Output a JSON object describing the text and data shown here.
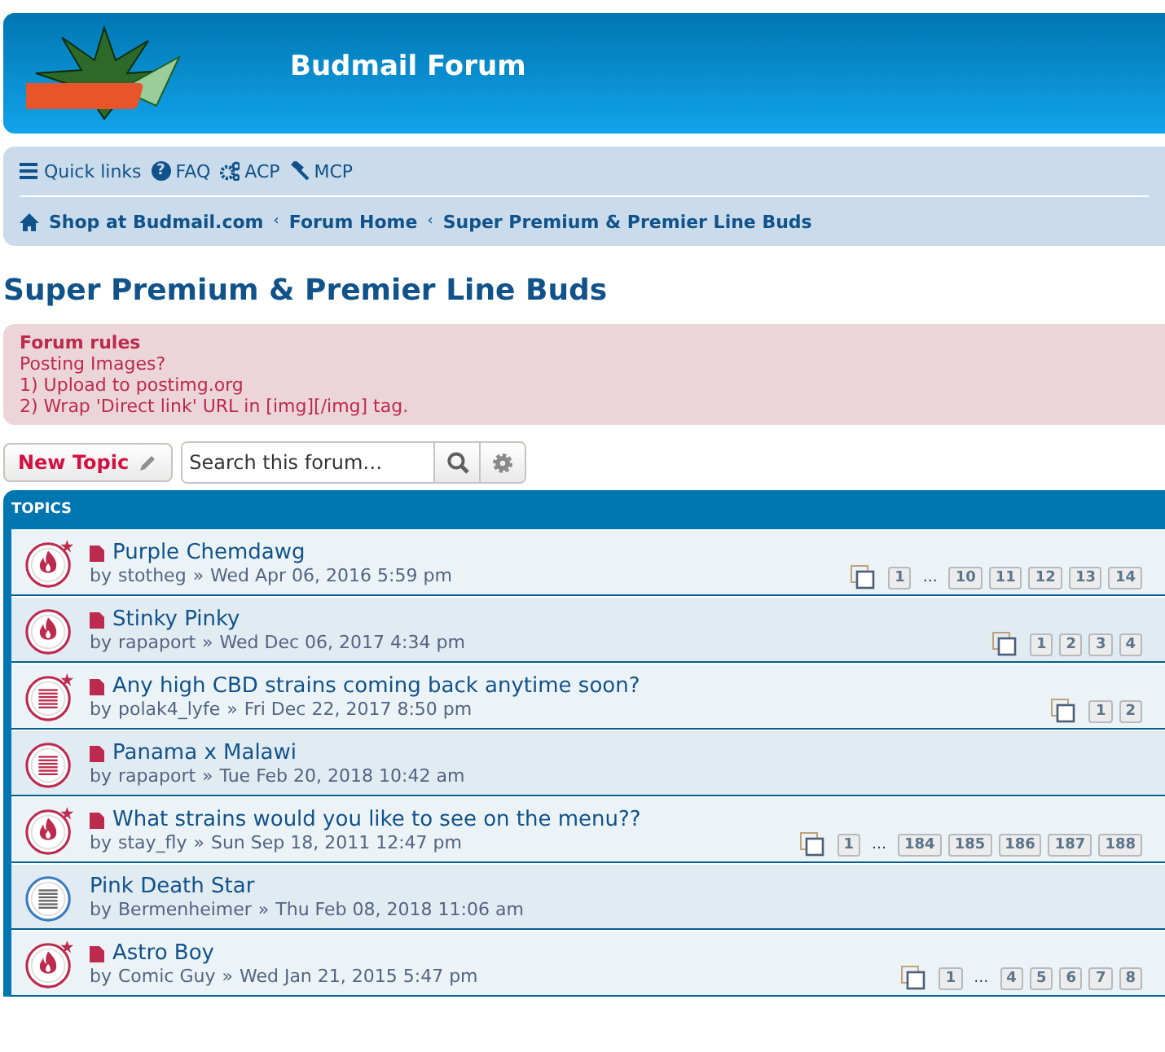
{
  "header": {
    "site_title": "Budmail Forum"
  },
  "navbar": {
    "links": [
      {
        "kind": "menu",
        "label": "Quick links"
      },
      {
        "kind": "help",
        "glyph": "?",
        "label": "FAQ"
      },
      {
        "kind": "gears",
        "label": "ACP"
      },
      {
        "kind": "gavel",
        "label": "MCP"
      }
    ],
    "breadcrumbs": [
      {
        "label": "Shop at Budmail.com",
        "home": true
      },
      {
        "sep": "‹",
        "label": "Forum Home",
        "home": false
      },
      {
        "sep": "‹",
        "label": "Super Premium & Premier Line Buds",
        "home": false
      }
    ]
  },
  "forum_title": "Super Premium & Premier Line Buds",
  "rules": {
    "title": "Forum rules",
    "lines": [
      "Posting Images?",
      "1) Upload to postimg.org",
      "2) Wrap 'Direct link' URL in [img][/img] tag."
    ]
  },
  "actions": {
    "new_topic": "New Topic",
    "search": {
      "placeholder": "Search this forum…"
    }
  },
  "topics": {
    "header": "TOPICS",
    "rows": [
      {
        "kind": "hot",
        "unread": true,
        "starred": true,
        "title": "Purple Chemdawg",
        "by": "by",
        "author": "stotheg",
        "sep": "»",
        "date": "Wed Apr 06, 2016 5:59 pm",
        "pages": [
          {
            "kind": "page",
            "label": "1"
          },
          {
            "kind": "ellipsis",
            "label": "…"
          },
          {
            "kind": "page",
            "label": "10"
          },
          {
            "kind": "page",
            "label": "11"
          },
          {
            "kind": "page",
            "label": "12"
          },
          {
            "kind": "page",
            "label": "13"
          },
          {
            "kind": "page",
            "label": "14"
          }
        ]
      },
      {
        "kind": "hot",
        "unread": true,
        "starred": false,
        "title": "Stinky Pinky",
        "by": "by",
        "author": "rapaport",
        "sep": "»",
        "date": "Wed Dec 06, 2017 4:34 pm",
        "pages": [
          {
            "kind": "page",
            "label": "1"
          },
          {
            "kind": "page",
            "label": "2"
          },
          {
            "kind": "page",
            "label": "3"
          },
          {
            "kind": "page",
            "label": "4"
          }
        ]
      },
      {
        "kind": "normal",
        "unread": true,
        "starred": true,
        "title": "Any high CBD strains coming back anytime soon?",
        "by": "by",
        "author": "polak4_lyfe",
        "sep": "»",
        "date": "Fri Dec 22, 2017 8:50 pm",
        "pages": [
          {
            "kind": "page",
            "label": "1"
          },
          {
            "kind": "page",
            "label": "2"
          }
        ]
      },
      {
        "kind": "normal",
        "unread": true,
        "starred": false,
        "title": "Panama x Malawi",
        "by": "by",
        "author": "rapaport",
        "sep": "»",
        "date": "Tue Feb 20, 2018 10:42 am"
      },
      {
        "kind": "hot",
        "unread": true,
        "starred": true,
        "title": "What strains would you like to see on the menu??",
        "by": "by",
        "author": "stay_fly",
        "sep": "»",
        "date": "Sun Sep 18, 2011 12:47 pm",
        "pages": [
          {
            "kind": "page",
            "label": "1"
          },
          {
            "kind": "ellipsis",
            "label": "…"
          },
          {
            "kind": "page",
            "label": "184"
          },
          {
            "kind": "page",
            "label": "185"
          },
          {
            "kind": "page",
            "label": "186"
          },
          {
            "kind": "page",
            "label": "187"
          },
          {
            "kind": "page",
            "label": "188"
          }
        ]
      },
      {
        "kind": "normal",
        "unread": false,
        "starred": false,
        "title": "Pink Death Star",
        "by": "by",
        "author": "Bermenheimer",
        "sep": "»",
        "date": "Thu Feb 08, 2018 11:06 am"
      },
      {
        "kind": "hot",
        "unread": true,
        "starred": true,
        "title": "Astro Boy",
        "by": "by",
        "author": "Comic Guy",
        "sep": "»",
        "date": "Wed Jan 21, 2015 5:47 pm",
        "pages": [
          {
            "kind": "page",
            "label": "1"
          },
          {
            "kind": "ellipsis",
            "label": "…"
          },
          {
            "kind": "page",
            "label": "4"
          },
          {
            "kind": "page",
            "label": "5"
          },
          {
            "kind": "page",
            "label": "6"
          },
          {
            "kind": "page",
            "label": "7"
          },
          {
            "kind": "page",
            "label": "8"
          }
        ]
      }
    ]
  }
}
